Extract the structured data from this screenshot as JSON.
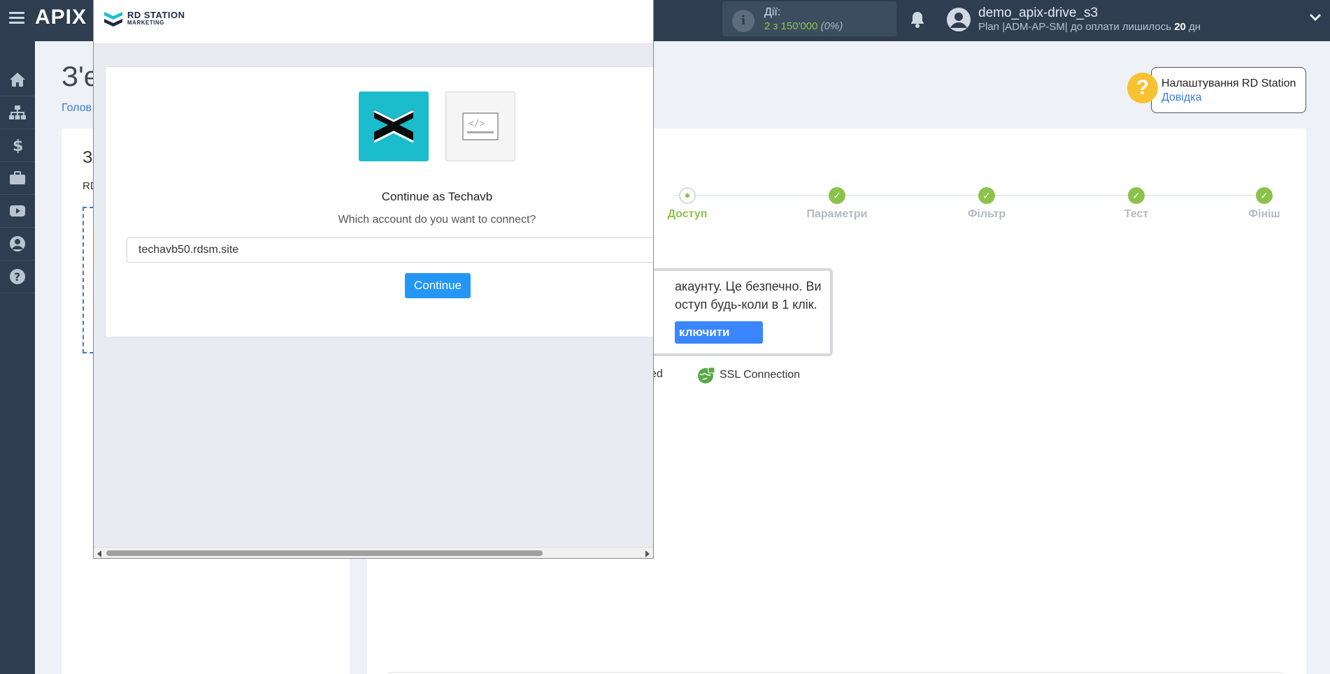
{
  "topbar": {
    "logo_left": "APIX",
    "logo_x": "",
    "actions_label": "Дії:",
    "actions_value": "2 з 150'000",
    "actions_pct": "(0%)",
    "user_name": "demo_apix-drive_s3",
    "user_plan": "Plan |ADM-AP-SM| до оплати лишилось",
    "user_days_num": "20",
    "user_days_unit": "дн"
  },
  "sidebar": {
    "items": [
      "home-icon",
      "sitemap-icon",
      "dollar-icon",
      "briefcase-icon",
      "youtube-icon",
      "user-circle-icon",
      "help-icon"
    ]
  },
  "main": {
    "title": "З'є",
    "breadcrumb": "Голов",
    "help_title": "Налаштування RD Station",
    "help_link": "Довідка",
    "left_title": "З",
    "left_sub": "RD",
    "steps": [
      {
        "label": "Доступ",
        "state": "current"
      },
      {
        "label": "Параметри",
        "state": "done"
      },
      {
        "label": "Фільтр",
        "state": "done"
      },
      {
        "label": "Тест",
        "state": "done"
      },
      {
        "label": "Фініш",
        "state": "done"
      }
    ],
    "access_line1": "акаунту. Це безпечно. Ви",
    "access_line2": "оступ будь-коли в 1 клік.",
    "access_button": "ключити",
    "trust_partial": "ed",
    "ssl_label": "SSL Connection"
  },
  "popup": {
    "brand_line1": "RD STATION",
    "brand_line2": "MARKETING",
    "continue_as": "Continue as Techavb",
    "which_account": "Which account do you want to connect?",
    "account_value": "techavb50.rdsm.site",
    "continue_button": "Continue"
  },
  "colors": {
    "accent": "#8bc34a",
    "primary_blue": "#3a86ff",
    "rd_teal": "#1bbccc",
    "sidebar_bg": "#2e3e50"
  }
}
